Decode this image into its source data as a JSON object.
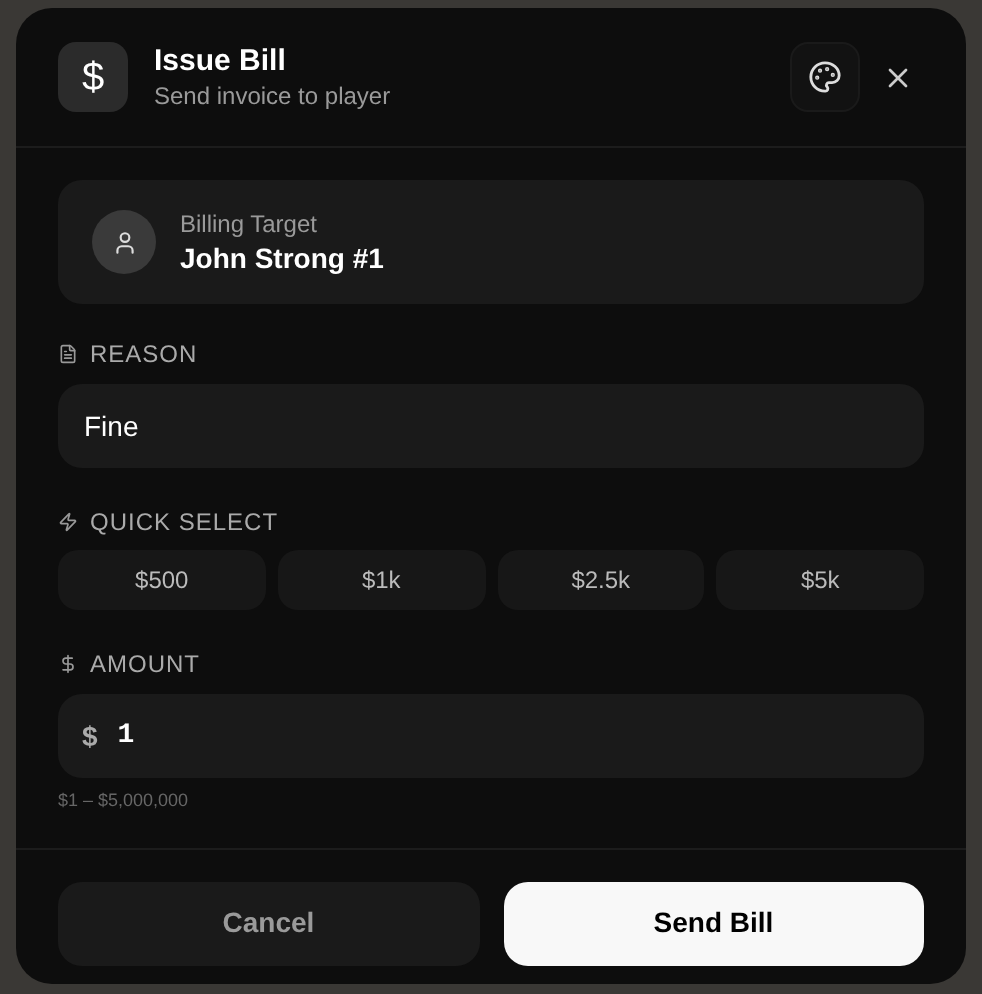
{
  "header": {
    "icon_symbol": "$",
    "title": "Issue Bill",
    "subtitle": "Send invoice to player"
  },
  "target": {
    "label": "Billing Target",
    "name": "John Strong #1"
  },
  "reason": {
    "label": "REASON",
    "value": "Fine"
  },
  "quick_select": {
    "label": "QUICK SELECT",
    "options": [
      "$500",
      "$1k",
      "$2.5k",
      "$5k"
    ]
  },
  "amount": {
    "label": "AMOUNT",
    "prefix": "$",
    "value": "1",
    "hint": "$1 – $5,000,000"
  },
  "buttons": {
    "cancel": "Cancel",
    "submit": "Send Bill"
  }
}
